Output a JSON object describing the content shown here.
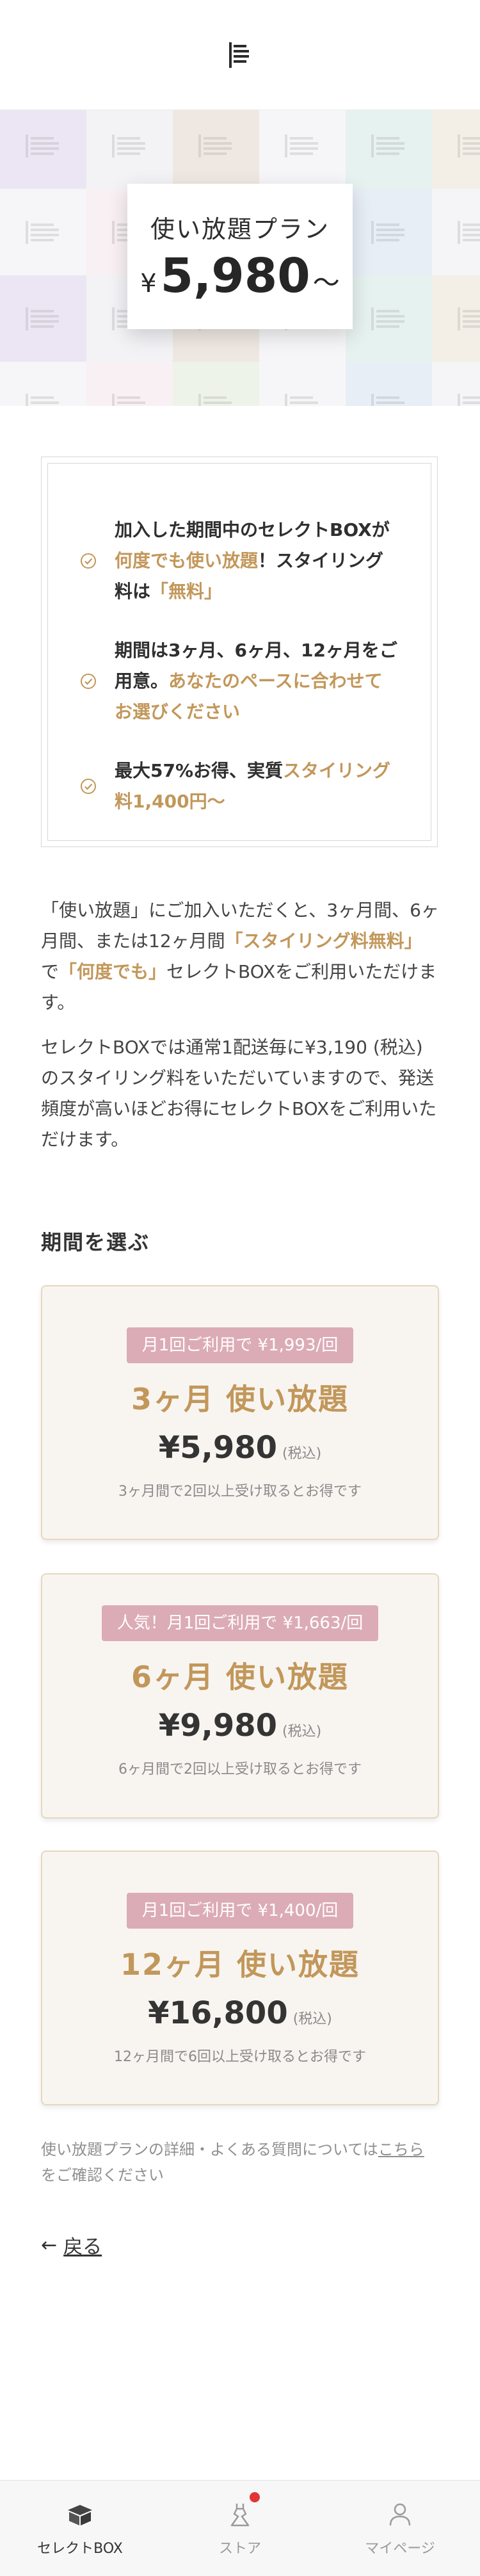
{
  "hero": {
    "plan_title": "使い放題プラン",
    "price_symbol": "¥",
    "price": "5,980",
    "price_suffix": "～"
  },
  "benefits": [
    {
      "parts": [
        {
          "t": "加入した期間中のセレクトBOXが",
          "hl": false
        },
        {
          "t": "何度でも使い放題",
          "hl": true
        },
        {
          "t": "！スタイリング料は",
          "hl": false
        },
        {
          "t": "「無料」",
          "hl": true
        }
      ]
    },
    {
      "parts": [
        {
          "t": "期間は3ヶ月、6ヶ月、12ヶ月をご用意。",
          "hl": false
        },
        {
          "t": "あなたのペースに合わせてお選びください",
          "hl": true
        }
      ]
    },
    {
      "parts": [
        {
          "t": "最大57%お得、実質",
          "hl": false
        },
        {
          "t": "スタイリング料1,400円～",
          "hl": true
        }
      ]
    }
  ],
  "description": {
    "p1_a": "「使い放題」にご加入いただくと、3ヶ月間、6ヶ月間、または12ヶ月間",
    "p1_b": "「スタイリング料無料」",
    "p1_c": "で",
    "p1_d": "「何度でも」",
    "p1_e": "セレクトBOXをご利用いただけます。",
    "p2": "セレクトBOXでは通常1配送毎に¥3,190 (税込)のスタイリング料をいただいていますので、発送頻度が高いほどお得にセレクトBOXをご利用いただけます。"
  },
  "section_title": "期間を選ぶ",
  "options": [
    {
      "badge": "月1回ご利用で ¥1,993/回",
      "title": "3ヶ月 使い放題",
      "price": "¥5,980",
      "tax": "(税込)",
      "note": "3ヶ月間で2回以上受け取るとお得です"
    },
    {
      "badge": "人気！月1回ご利用で ¥1,663/回",
      "title": "6ヶ月 使い放題",
      "price": "¥9,980",
      "tax": "(税込)",
      "note": "6ヶ月間で2回以上受け取るとお得です"
    },
    {
      "badge": "月1回ご利用で ¥1,400/回",
      "title": "12ヶ月 使い放題",
      "price": "¥16,800",
      "tax": "(税込)",
      "note": "12ヶ月間で6回以上受け取るとお得です"
    }
  ],
  "footnote": {
    "before": "使い放題プランの詳細・よくある質問については",
    "link": "こちら",
    "after": "をご確認ください"
  },
  "back_label": "戻る",
  "bottom_nav": [
    {
      "label": "セレクトBOX",
      "icon": "box-icon"
    },
    {
      "label": "ストア",
      "icon": "dress-icon"
    },
    {
      "label": "マイページ",
      "icon": "user-icon"
    }
  ],
  "colors": {
    "accent": "#c2975a",
    "badge": "#dcacb6",
    "card_bg": "#f8f5f1",
    "notification": "#e23434"
  }
}
